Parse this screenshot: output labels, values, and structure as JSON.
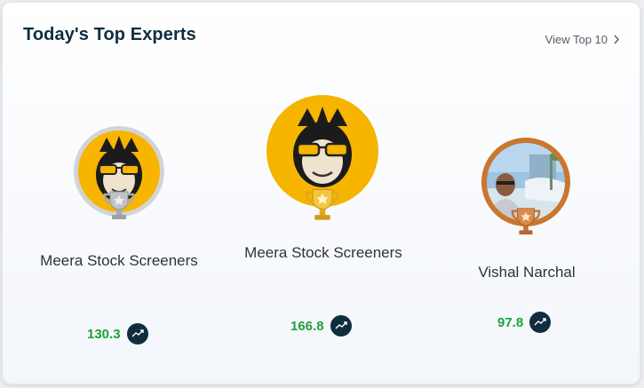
{
  "header": {
    "title": "Today's Top Experts",
    "view_all_label": "View Top 10"
  },
  "experts": [
    {
      "rank": 2,
      "name": "Meera Stock Screeners",
      "score": "130.3",
      "trophy": "silver",
      "avatar": "monkey-with-sunglasses"
    },
    {
      "rank": 1,
      "name": "Meera Stock Screeners",
      "score": "166.8",
      "trophy": "gold",
      "avatar": "monkey-with-sunglasses"
    },
    {
      "rank": 3,
      "name": "Vishal Narchal",
      "score": "97.8",
      "trophy": "bronze",
      "avatar": "profile-photo"
    }
  ],
  "colors": {
    "title": "#0f2d3f",
    "score": "#1fa23a",
    "trend_button": "#0f2d3f",
    "gold_ring": "#f4b400",
    "silver_ring": "#c9cbce",
    "bronze_ring": "#c9772f"
  },
  "icons": [
    "chevron-right-icon",
    "trend-chart-icon",
    "silver-trophy-icon",
    "gold-trophy-icon",
    "bronze-trophy-icon"
  ]
}
